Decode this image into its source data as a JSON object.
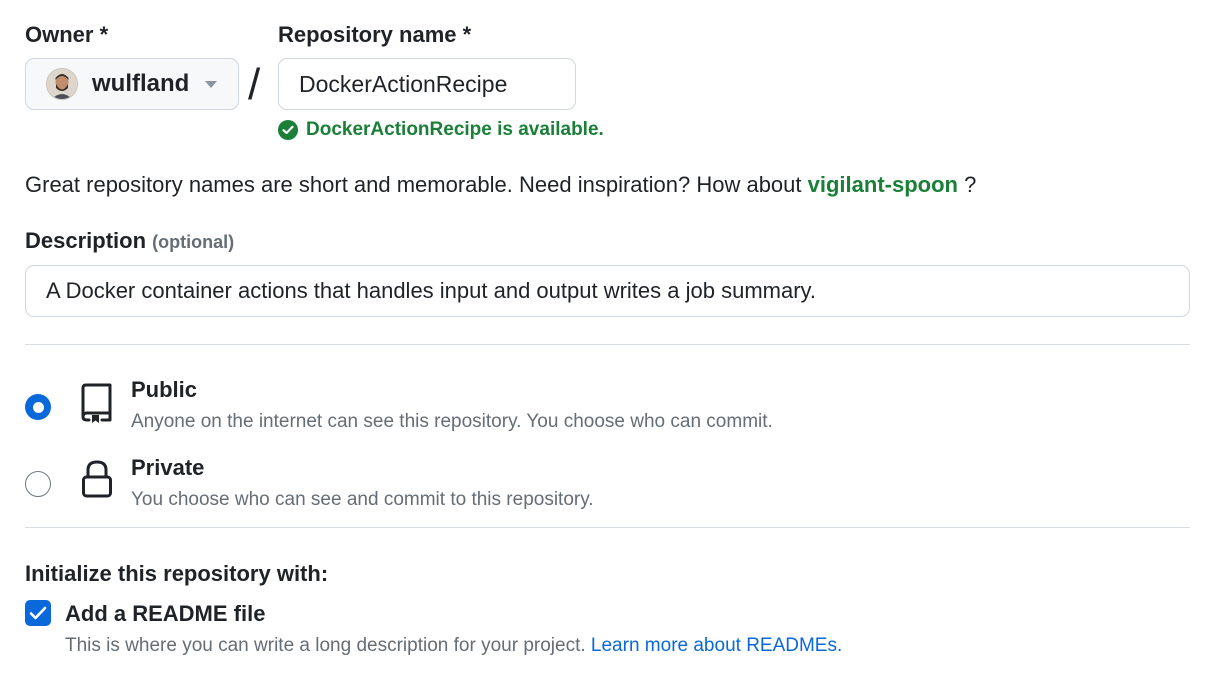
{
  "owner": {
    "label": "Owner *",
    "value": "wulfland"
  },
  "repository": {
    "label": "Repository name *",
    "value": "DockerActionRecipe",
    "availability": "DockerActionRecipe is available."
  },
  "slash": "/",
  "suggestion": {
    "text": "Great repository names are short and memorable. Need inspiration? How about",
    "name": "vigilant-spoon",
    "suffix": "?"
  },
  "description": {
    "label": "Description",
    "optional": "(optional)",
    "value": "A Docker container actions that handles input and output writes a job summary."
  },
  "visibility": {
    "selected": "public",
    "public": {
      "title": "Public",
      "desc": "Anyone on the internet can see this repository. You choose who can commit.",
      "icon": "repo-icon"
    },
    "private": {
      "title": "Private",
      "desc": "You choose who can see and commit to this repository.",
      "icon": "lock-icon"
    }
  },
  "initialize": {
    "label": "Initialize this repository with:",
    "readme": {
      "checked": true,
      "title": "Add a README file",
      "desc": "This is where you can write a long description for your project.",
      "link": "Learn more about READMEs."
    }
  },
  "colors": {
    "accent": "#0969da",
    "success": "#1a7f37",
    "muted": "#656d76",
    "border": "#d0d7de"
  }
}
